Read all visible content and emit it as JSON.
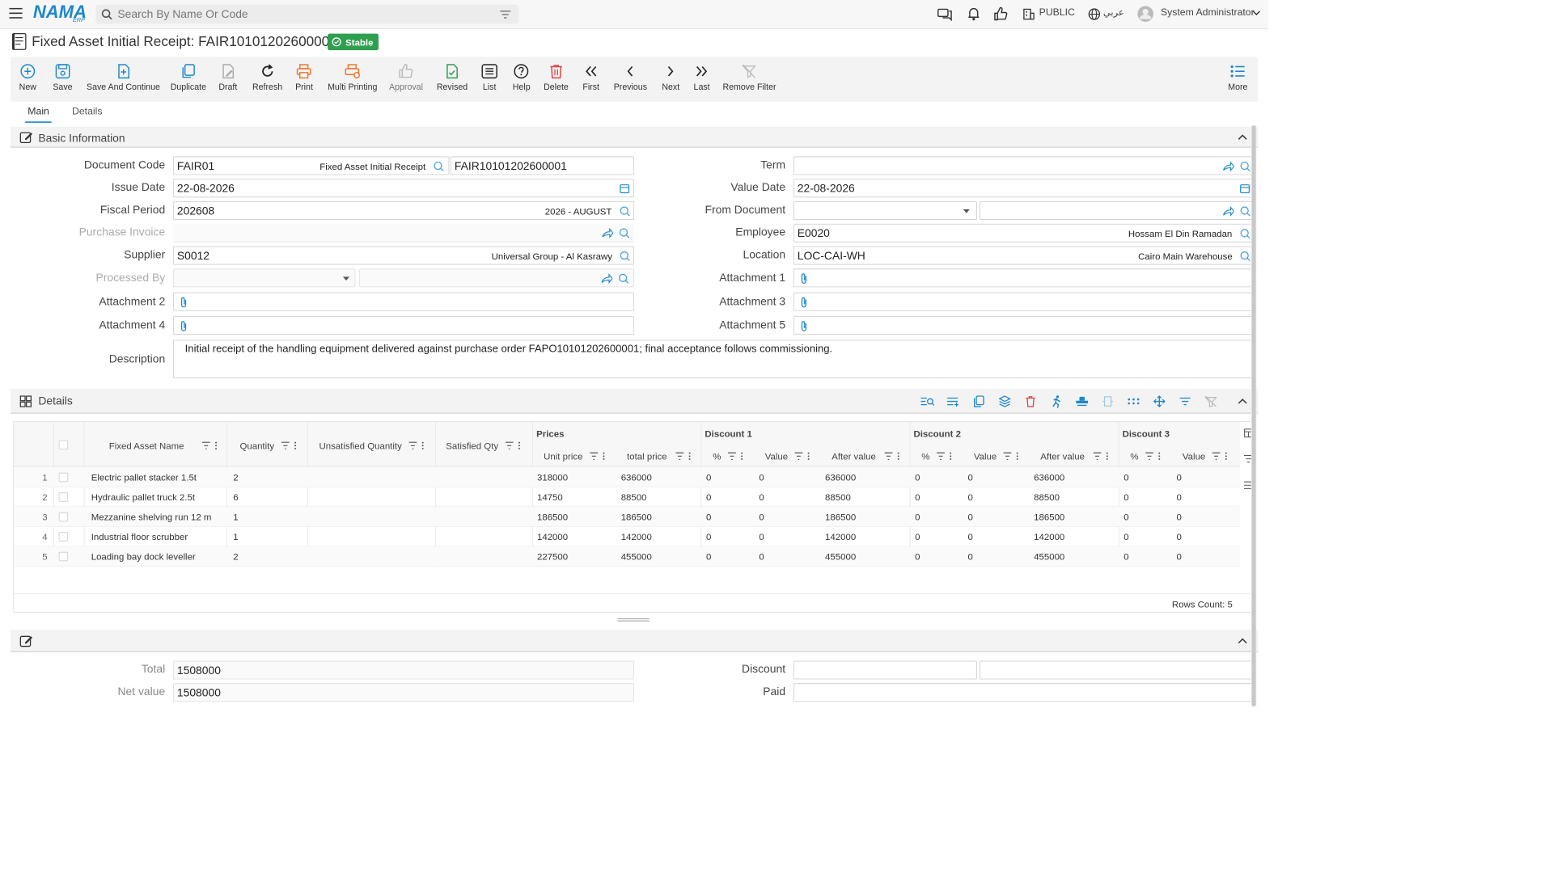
{
  "app": {
    "logo_main": "NAMA",
    "logo_sub": "ERP",
    "search_placeholder": "Search By Name Or Code",
    "scope": "PUBLIC",
    "lang": "عربي",
    "user": "System Administrator"
  },
  "page": {
    "title": "Fixed Asset Initial Receipt: FAIR10101202600001",
    "status": "Stable"
  },
  "toolbar": [
    {
      "label": "New",
      "icon": "plus-circle-icon"
    },
    {
      "label": "Save",
      "icon": "save-icon"
    },
    {
      "label": "Save And Continue",
      "icon": "save-continue-icon"
    },
    {
      "label": "Duplicate",
      "icon": "duplicate-icon"
    },
    {
      "label": "Draft",
      "icon": "draft-icon"
    },
    {
      "label": "Refresh",
      "icon": "refresh-icon"
    },
    {
      "label": "Print",
      "icon": "print-icon"
    },
    {
      "label": "Multi Printing",
      "icon": "multi-print-icon"
    },
    {
      "label": "Approval",
      "icon": "thumbs-up-icon"
    },
    {
      "label": "Revised",
      "icon": "revised-icon"
    },
    {
      "label": "List",
      "icon": "list-icon"
    },
    {
      "label": "Help",
      "icon": "help-icon"
    },
    {
      "label": "Delete",
      "icon": "trash-icon"
    },
    {
      "label": "First",
      "icon": "first-icon"
    },
    {
      "label": "Previous",
      "icon": "previous-icon"
    },
    {
      "label": "Next",
      "icon": "next-icon"
    },
    {
      "label": "Last",
      "icon": "last-icon"
    },
    {
      "label": "Remove Filter",
      "icon": "remove-filter-icon"
    },
    {
      "label": "More",
      "icon": "more-icon"
    }
  ],
  "tabs": [
    "Main",
    "Details"
  ],
  "basic": {
    "title": "Basic Information",
    "document_code_label": "Document Code",
    "document_code": "FAIR01",
    "document_type": "Fixed Asset Initial Receipt",
    "document_number": "FAIR10101202600001",
    "issue_date_label": "Issue Date",
    "issue_date": "22-08-2026",
    "fiscal_period_label": "Fiscal Period",
    "fiscal_period": "202608",
    "fiscal_period_name": "2026 - AUGUST",
    "purchase_invoice_label": "Purchase Invoice",
    "supplier_label": "Supplier",
    "supplier_code": "S0012",
    "supplier_name": "Universal Group - Al Kasrawy",
    "processed_by_label": "Processed By",
    "attachment2_label": "Attachment 2",
    "attachment4_label": "Attachment 4",
    "term_label": "Term",
    "value_date_label": "Value Date",
    "value_date": "22-08-2026",
    "from_document_label": "From Document",
    "employee_label": "Employee",
    "employee_code": "E0020",
    "employee_name": "Hossam El Din Ramadan",
    "location_label": "Location",
    "location_code": "LOC-CAI-WH",
    "location_name": "Cairo Main Warehouse",
    "attachment1_label": "Attachment 1",
    "attachment3_label": "Attachment 3",
    "attachment5_label": "Attachment 5",
    "description_label": "Description",
    "description": "Initial receipt of the handling equipment delivered against purchase order FAPO10101202600001; final acceptance follows commissioning."
  },
  "details": {
    "title": "Details",
    "headers": {
      "name": "Fixed Asset Name",
      "qty": "Quantity",
      "unsat": "Unsatisfied Quantity",
      "sat": "Satisfied Qty",
      "prices": "Prices",
      "unit_price": "Unit price",
      "total_price": "total price",
      "d1": "Discount 1",
      "d2": "Discount 2",
      "d3": "Discount 3",
      "pct": "%",
      "value": "Value",
      "after": "After value"
    },
    "rows": [
      {
        "n": "1",
        "name": "Electric pallet stacker 1.5t",
        "qty": "2",
        "unit": "318000",
        "total": "636000",
        "d1p": "0",
        "d1v": "0",
        "d1a": "636000",
        "d2p": "0",
        "d2v": "0",
        "d2a": "636000",
        "d3p": "0",
        "d3v": "0"
      },
      {
        "n": "2",
        "name": "Hydraulic pallet truck 2.5t",
        "qty": "6",
        "unit": "14750",
        "total": "88500",
        "d1p": "0",
        "d1v": "0",
        "d1a": "88500",
        "d2p": "0",
        "d2v": "0",
        "d2a": "88500",
        "d3p": "0",
        "d3v": "0"
      },
      {
        "n": "3",
        "name": "Mezzanine shelving run 12 m",
        "qty": "1",
        "unit": "186500",
        "total": "186500",
        "d1p": "0",
        "d1v": "0",
        "d1a": "186500",
        "d2p": "0",
        "d2v": "0",
        "d2a": "186500",
        "d3p": "0",
        "d3v": "0"
      },
      {
        "n": "4",
        "name": "Industrial floor scrubber",
        "qty": "1",
        "unit": "142000",
        "total": "142000",
        "d1p": "0",
        "d1v": "0",
        "d1a": "142000",
        "d2p": "0",
        "d2v": "0",
        "d2a": "142000",
        "d3p": "0",
        "d3v": "0"
      },
      {
        "n": "5",
        "name": "Loading bay dock leveller",
        "qty": "2",
        "unit": "227500",
        "total": "455000",
        "d1p": "0",
        "d1v": "0",
        "d1a": "455000",
        "d2p": "0",
        "d2v": "0",
        "d2a": "455000",
        "d3p": "0",
        "d3v": "0"
      }
    ],
    "rows_count": "Rows Count: 5"
  },
  "totals": {
    "total_label": "Total",
    "total": "1508000",
    "net_label": "Net value",
    "net": "1508000",
    "discount_label": "Discount",
    "paid_label": "Paid"
  },
  "colors": {
    "brand": "#1e88c9",
    "stable": "#2e9e4f",
    "delete": "#e04545",
    "print": "#f0732a"
  }
}
